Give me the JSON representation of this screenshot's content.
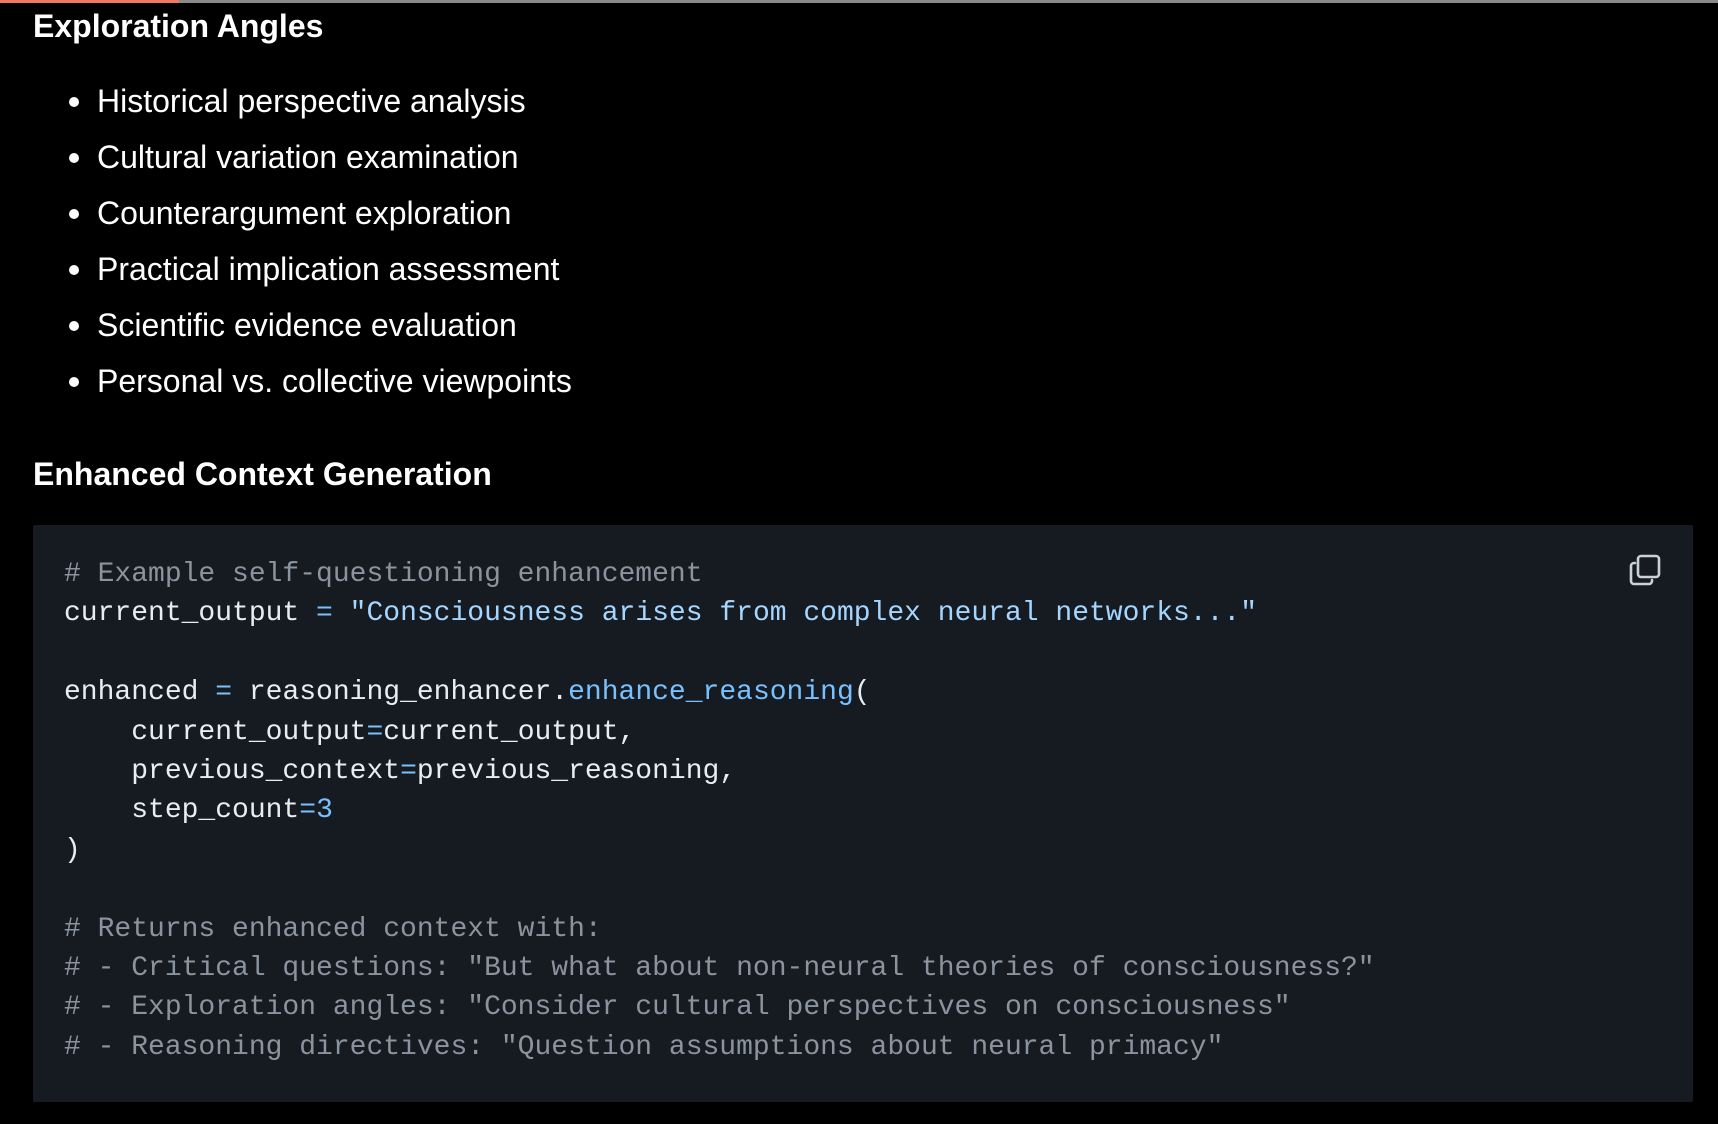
{
  "page": {
    "progress_fraction": 0.104,
    "accent_color": "#f07a5f"
  },
  "sections": {
    "exploration": {
      "title": "Exploration Angles",
      "items": [
        "Historical perspective analysis",
        "Cultural variation examination",
        "Counterargument exploration",
        "Practical implication assessment",
        "Scientific evidence evaluation",
        "Personal vs. collective viewpoints"
      ]
    },
    "context": {
      "title": "Enhanced Context Generation"
    }
  },
  "code": {
    "copy_icon": "copy-icon",
    "lines": [
      [
        {
          "t": "comment",
          "v": "# Example self-questioning enhancement"
        }
      ],
      [
        {
          "t": "plain",
          "v": "current_output "
        },
        {
          "t": "op",
          "v": "="
        },
        {
          "t": "plain",
          "v": " "
        },
        {
          "t": "string",
          "v": "\"Consciousness arises from complex neural networks...\""
        }
      ],
      [],
      [
        {
          "t": "plain",
          "v": "enhanced "
        },
        {
          "t": "op",
          "v": "="
        },
        {
          "t": "plain",
          "v": " reasoning_enhancer."
        },
        {
          "t": "func",
          "v": "enhance_reasoning"
        },
        {
          "t": "plain",
          "v": "("
        }
      ],
      [
        {
          "t": "plain",
          "v": "    current_output"
        },
        {
          "t": "op",
          "v": "="
        },
        {
          "t": "plain",
          "v": "current_output,"
        }
      ],
      [
        {
          "t": "plain",
          "v": "    previous_context"
        },
        {
          "t": "op",
          "v": "="
        },
        {
          "t": "plain",
          "v": "previous_reasoning,"
        }
      ],
      [
        {
          "t": "plain",
          "v": "    step_count"
        },
        {
          "t": "op",
          "v": "="
        },
        {
          "t": "num",
          "v": "3"
        }
      ],
      [
        {
          "t": "plain",
          "v": ")"
        }
      ],
      [],
      [
        {
          "t": "comment",
          "v": "# Returns enhanced context with:"
        }
      ],
      [
        {
          "t": "comment",
          "v": "# - Critical questions: \"But what about non-neural theories of consciousness?\""
        }
      ],
      [
        {
          "t": "comment",
          "v": "# - Exploration angles: \"Consider cultural perspectives on consciousness\""
        }
      ],
      [
        {
          "t": "comment",
          "v": "# - Reasoning directives: \"Question assumptions about neural primacy\""
        }
      ]
    ]
  }
}
